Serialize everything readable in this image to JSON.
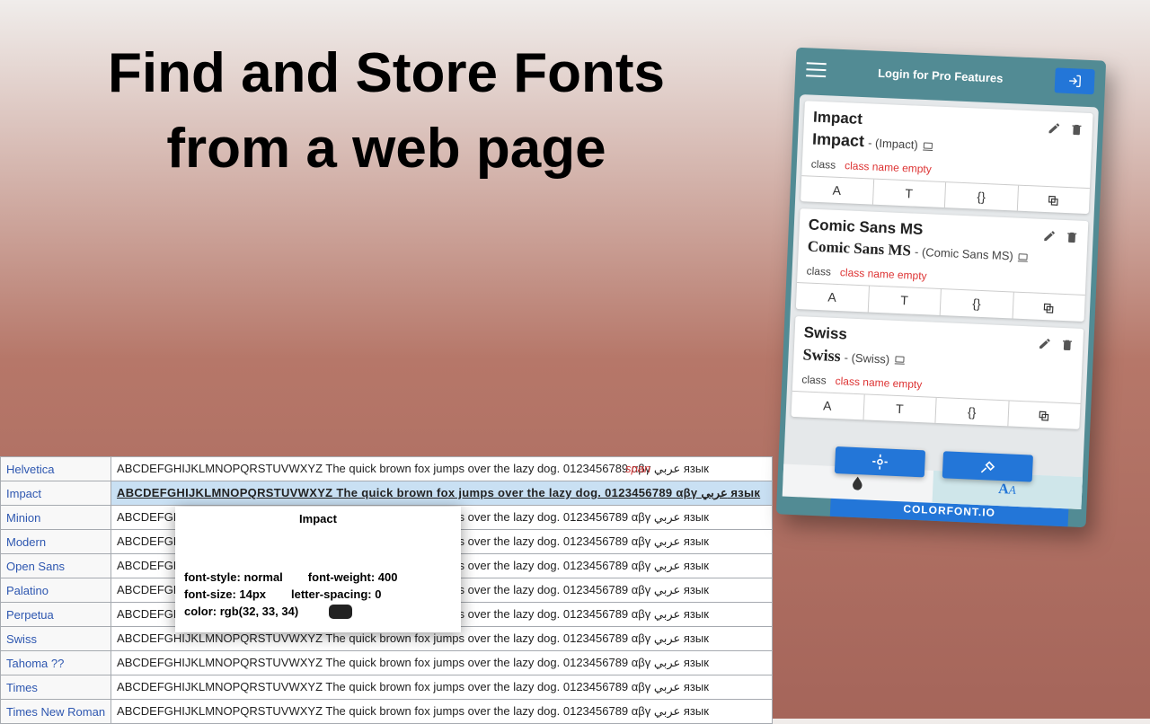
{
  "headline": "Find and Store Fonts from a web page",
  "span_tag": "span",
  "table": {
    "sample_text": "ABCDEFGHIJKLMNOPQRSTUVWXYZ The quick brown fox jumps over the lazy dog. 0123456789 αβγ عربي язык",
    "rows": [
      {
        "name": "Helvetica",
        "highlighted": false
      },
      {
        "name": "Impact",
        "highlighted": true
      },
      {
        "name": "Minion",
        "highlighted": false
      },
      {
        "name": "Modern",
        "highlighted": false
      },
      {
        "name": "Open Sans",
        "highlighted": false
      },
      {
        "name": "Palatino",
        "highlighted": false
      },
      {
        "name": "Perpetua",
        "highlighted": false
      },
      {
        "name": "Swiss",
        "highlighted": false
      },
      {
        "name": "Tahoma ??",
        "highlighted": false
      },
      {
        "name": "Times",
        "highlighted": false
      },
      {
        "name": "Times New Roman",
        "highlighted": false
      }
    ]
  },
  "tooltip": {
    "title": "Impact",
    "font_style": "font-style: normal",
    "font_weight": "font-weight: 400",
    "font_size": "font-size: 14px",
    "letter_spacing": "letter-spacing: 0",
    "color": "color: rgb(32, 33, 34)"
  },
  "panel": {
    "login_label": "Login for Pro Features",
    "brand": "COLORFONT.IO",
    "class_label": "class",
    "class_empty": "class name empty",
    "footer_buttons": [
      "A",
      "T",
      "{}",
      "⧉"
    ],
    "cards": [
      {
        "title": "Impact",
        "preview_main": "Impact",
        "preview_sub": "- (Impact)",
        "style": "impact"
      },
      {
        "title": "Comic Sans MS",
        "preview_main": "Comic Sans MS",
        "preview_sub": "- (Comic Sans MS)",
        "style": "comic"
      },
      {
        "title": "Swiss",
        "preview_main": "Swiss",
        "preview_sub": "- (Swiss)",
        "style": "swiss"
      }
    ]
  }
}
